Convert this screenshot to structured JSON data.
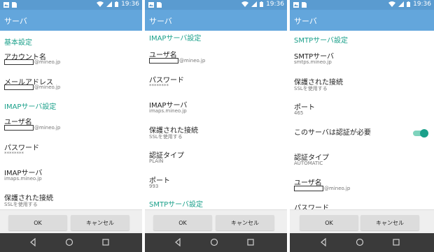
{
  "status_time": "19:36",
  "app_title": "サーバ",
  "buttons": {
    "ok": "OK",
    "cancel": "キャンセル"
  },
  "screen1": {
    "section_basic": "基本設定",
    "account_label": "アカウント名",
    "account_domain": "@mineo.jp",
    "mail_label": "メールアドレス",
    "mail_domain": "@mineo.jp",
    "section_imap": "IMAPサーバ設定",
    "user_label": "ユーザ名",
    "user_domain": "@mineo.jp",
    "password_label": "パスワード",
    "password_value": "********",
    "imap_server_label": "IMAPサーバ",
    "imap_server_value": "imaps.mineo.jp",
    "secure_label": "保護された接続",
    "secure_value": "SSLを使用する"
  },
  "screen2": {
    "section_imap": "IMAPサーバ設定",
    "user_label": "ユーザ名",
    "user_domain": "@mineo.jp",
    "password_label": "パスワード",
    "password_value": "********",
    "imap_server_label": "IMAPサーバ",
    "imap_server_value": "imaps.mineo.jp",
    "secure_label": "保護された接続",
    "secure_value": "SSLを使用する",
    "auth_label": "認証タイプ",
    "auth_value": "PLAIN",
    "port_label": "ポート",
    "port_value": "993",
    "section_smtp": "SMTPサーバ設定"
  },
  "screen3": {
    "section_smtp": "SMTPサーバ設定",
    "smtp_server_label": "SMTPサーバ",
    "smtp_server_value": "smtps.mineo.jp",
    "secure_label": "保護された接続",
    "secure_value": "SSLを使用する",
    "port_label": "ポート",
    "port_value": "465",
    "auth_required_label": "このサーバは認証が必要",
    "auth_required_on": true,
    "auth_label": "認証タイプ",
    "auth_value": "AUTOMATIC",
    "user_label": "ユーザ名",
    "user_domain": "@mineo.jp",
    "password_label": "パスワード"
  }
}
